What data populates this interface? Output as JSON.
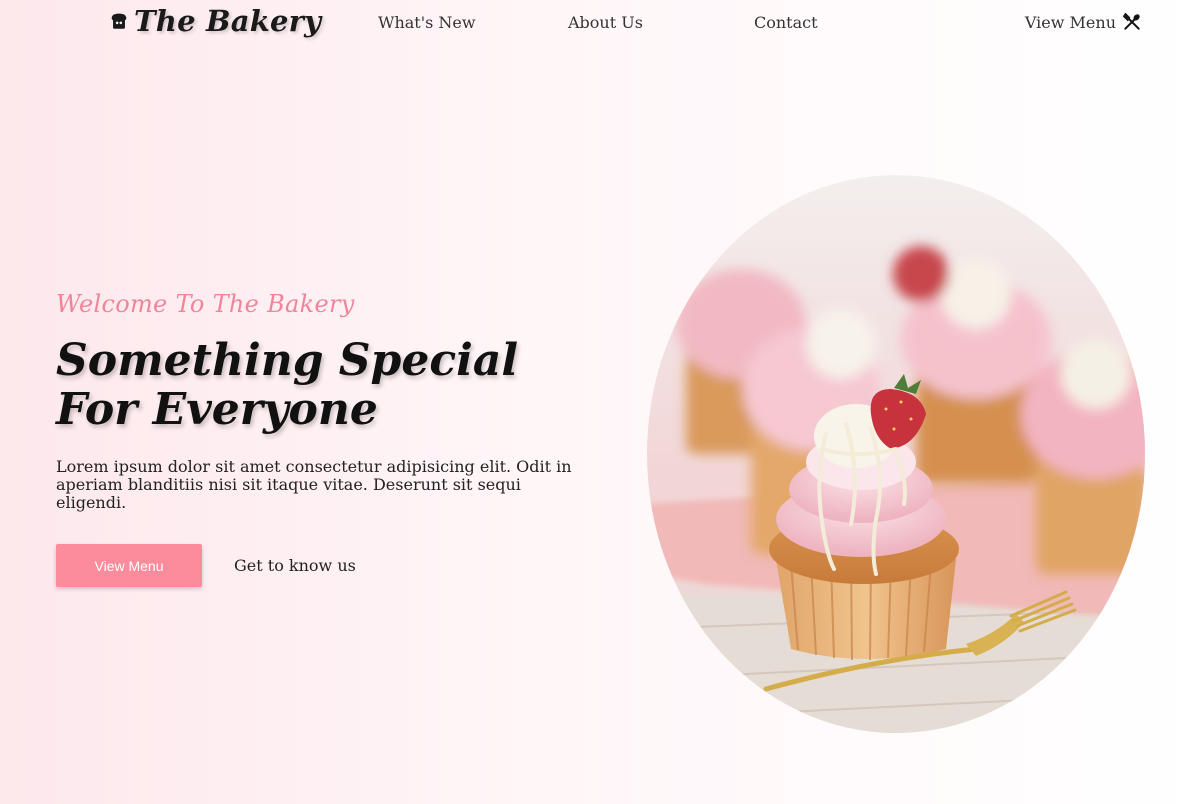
{
  "nav": {
    "logo_text": "The Bakery",
    "logo_icon": "bread-icon",
    "links": [
      "What's New",
      "About Us",
      "Contact"
    ],
    "menu_label": "View Menu",
    "menu_icon": "utensils-icon"
  },
  "hero": {
    "welcome": "Welcome To The Bakery",
    "headline": "Something Special For Everyone",
    "description": "Lorem ipsum dolor sit amet consectetur adipisicing elit. Odit in aperiam blanditiis nisi sit itaque vitae. Deserunt sit sequi eligendi.",
    "primary_button": "View Menu",
    "secondary_link": "Get to know us"
  },
  "colors": {
    "accent_pink": "#fc8b9b",
    "welcome_pink": "#f0849a",
    "background_pink": "#fde8ec"
  }
}
